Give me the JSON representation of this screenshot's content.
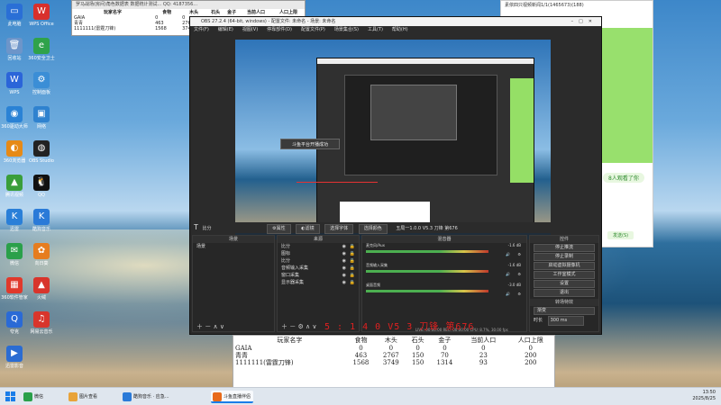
{
  "desktop_icons": [
    {
      "label": "此电脑",
      "color": "#2a6fd6",
      "glyph": "▭"
    },
    {
      "label": "WPS Office",
      "color": "#d9302c",
      "glyph": "W"
    },
    {
      "label": "回收站",
      "color": "#6d95c9",
      "glyph": "🗑"
    },
    {
      "label": "360安全卫士",
      "color": "#2fa24a",
      "glyph": "e"
    },
    {
      "label": "WPS",
      "color": "#2b65d9",
      "glyph": "W"
    },
    {
      "label": "控制面板",
      "color": "#3b8ed6",
      "glyph": "⚙"
    },
    {
      "label": "360驱动大师",
      "color": "#2a82d5",
      "glyph": "◉"
    },
    {
      "label": "网络",
      "color": "#2f82cf",
      "glyph": "▣"
    },
    {
      "label": "360浏览器",
      "color": "#e68a17",
      "glyph": "◐"
    },
    {
      "label": "OBS Studio",
      "color": "#222222",
      "glyph": "◍"
    },
    {
      "label": "腾讯视频",
      "color": "#3a9e3a",
      "glyph": "▲"
    },
    {
      "label": "QQ",
      "color": "#111111",
      "glyph": "🐧"
    },
    {
      "label": "迅雷",
      "color": "#2a7fd8",
      "glyph": "K"
    },
    {
      "label": "酷狗音乐",
      "color": "#2a7ad8",
      "glyph": "K"
    },
    {
      "label": "微信",
      "color": "#2aa04a",
      "glyph": "✉"
    },
    {
      "label": "向日葵",
      "color": "#e67d1f",
      "glyph": "✿"
    },
    {
      "label": "360软件管家",
      "color": "#e0392c",
      "glyph": "▦"
    },
    {
      "label": "火绒",
      "color": "#d8352c",
      "glyph": "▲"
    },
    {
      "label": "夸克",
      "color": "#2a6ad6",
      "glyph": "Q"
    },
    {
      "label": "网易云音乐",
      "color": "#d8352c",
      "glyph": "♫"
    },
    {
      "label": "迅雷影音",
      "color": "#2b6cd2",
      "glyph": "▶"
    }
  ],
  "top_table": {
    "title": "罗马战场(房间)角色数据表  数据统计测试...  QQ: 4187356...",
    "headers": [
      "玩家名字",
      "食物",
      "木头",
      "石头",
      "金子",
      "当前人口",
      "人口上限"
    ],
    "rows": [
      [
        "GAIA",
        "0",
        "0",
        "",
        "",
        "",
        ""
      ],
      [
        "青青",
        "463",
        "2767",
        "",
        "",
        "",
        ""
      ],
      [
        "1111111(雷霆刀锋)",
        "1568",
        "3749",
        "",
        "",
        "",
        ""
      ]
    ]
  },
  "right_window": {
    "header_text": "素依四只视频新闻1/1(1465673)(188)",
    "tag_label": "8人观看了你",
    "send_label": "发送(S)"
  },
  "obs": {
    "title": "OBS 27.2.4 (64-bit, windows) - 配置文件: 未命名 - 场景: 未命名",
    "menu": [
      "文件(F)",
      "编辑(E)",
      "视图(V)",
      "停靠部件(D)",
      "配置文件(P)",
      "场景集合(S)",
      "工具(T)",
      "帮助(H)"
    ],
    "source_bar": {
      "name": "比分",
      "properties_label": "属性",
      "filters_label": "滤镜",
      "select_font_label": "选择字体",
      "select_color_label": "选择颜色",
      "text_value": "五局一1.0.0 V5.3 刀锋 第676"
    },
    "preview_popup_text": "斗鱼平台开播成功",
    "scenes": {
      "header": "场景",
      "items": [
        "场景"
      ]
    },
    "sources": {
      "header": "来源",
      "items": [
        "比分",
        "图标",
        "比分",
        "音频输入采集",
        "窗口采集",
        "显示器采集"
      ]
    },
    "mixer": {
      "header": "混音器",
      "channels": [
        {
          "name": "麦克风/Aux",
          "db": "-1.6 dB"
        },
        {
          "name": "音频输入采集",
          "db": "-1.6 dB"
        },
        {
          "name": "桌面音频",
          "db": "-3.0 dB"
        }
      ]
    },
    "controls": {
      "header": "控件",
      "buttons": [
        "停止推流",
        "停止录制",
        "启动虚拟摄像机",
        "工作室模式",
        "设置",
        "退出"
      ]
    },
    "transitions": {
      "header": "转场特效",
      "type": "渐变",
      "duration_label": "时长",
      "duration": "300 ms"
    },
    "status": "LIVE: 00:00:00   REC: 00:00:00   CPU: 8.7%, 30.00 fps",
    "overlay_text": "5 : 1 4 0 V5 3 刀锋 第676"
  },
  "bottom_table": {
    "headers": [
      "玩家名字",
      "食物",
      "木头",
      "石头",
      "金子",
      "当前人口",
      "人口上限"
    ],
    "rows": [
      [
        "GAIA",
        "0",
        "0",
        "0",
        "0",
        "0",
        "0"
      ],
      [
        "青青",
        "463",
        "2767",
        "150",
        "70",
        "23",
        "200"
      ],
      [
        "1111111(雷霆刀锋)",
        "1568",
        "3749",
        "150",
        "1314",
        "93",
        "200"
      ]
    ]
  },
  "taskbar": {
    "items": [
      {
        "label": "微信",
        "color": "#2aa04a"
      },
      {
        "label": "图片查看",
        "color": "#e8a33a"
      },
      {
        "label": "酷狗音乐 · 应急...",
        "color": "#2a7ad8"
      },
      {
        "label": "斗鱼直播伴侣",
        "color": "#e86a1a"
      }
    ],
    "time": "13:50",
    "date": "2025/8/25"
  }
}
